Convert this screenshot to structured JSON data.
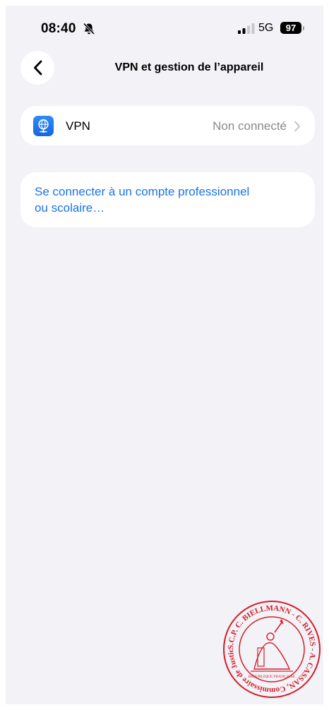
{
  "status_bar": {
    "time": "08:40",
    "network": "5G",
    "battery": "97",
    "icons": [
      "bell-slash-icon",
      "signal-icon"
    ]
  },
  "nav": {
    "title": "VPN et gestion de l’appareil",
    "back_icon": "chevron-left-icon"
  },
  "vpn_row": {
    "label": "VPN",
    "status": "Non connecté",
    "icon": "vpn-globe-icon",
    "icon_color": "#1a73e8"
  },
  "work_account": {
    "label_line1": "Se connecter à un compte professionnel",
    "label_line2": "ou scolaire…",
    "color": "#1a73e8"
  },
  "stamp": {
    "text": "S.C.P. C. BIELLMANN - C. RIVES - A. CASSAN, Commissaire de Justice Associés",
    "inner_text": "RÉPUBLIQUE FRANÇAISE",
    "color": "#d11f2a"
  }
}
